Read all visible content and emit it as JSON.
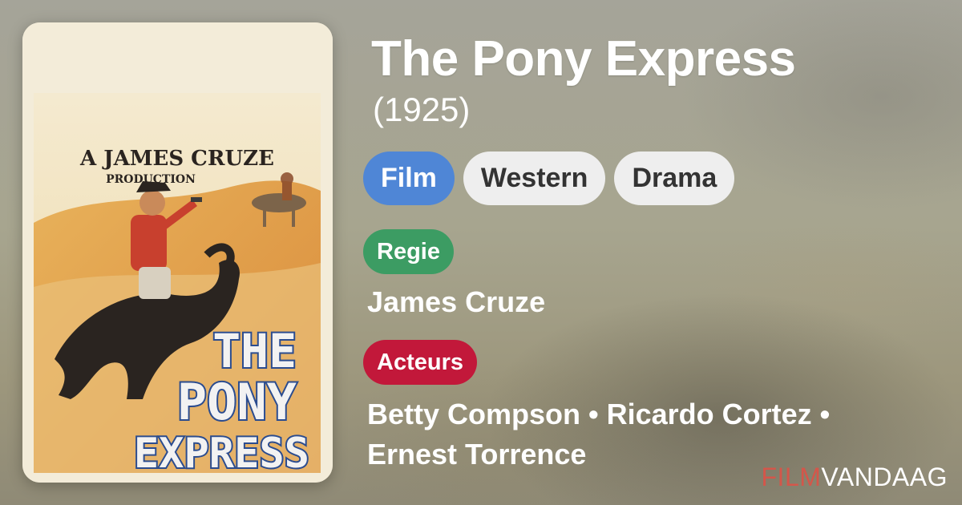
{
  "movie": {
    "title": "The Pony Express",
    "year": "(1925)"
  },
  "genres": [
    "Film",
    "Western",
    "Drama"
  ],
  "director_label": "Regie",
  "director": "James Cruze",
  "actors_label": "Acteurs",
  "actors": [
    "Betty Compson",
    "Ricardo Cortez",
    "Ernest Torrence"
  ],
  "actor_separator": " • ",
  "poster": {
    "top_line": "A JAMES CRUZE",
    "sub_line": "PRODUCTION",
    "title_words": [
      "THE",
      "PONY",
      "EXPRESS"
    ]
  },
  "brand": {
    "part1": "FILM",
    "part2": "VANDAAG"
  },
  "colors": {
    "film_chip": "#4f86d6",
    "regie_badge": "#3c9c63",
    "acteurs_badge": "#c2183a",
    "brand_accent": "#d4564a"
  }
}
